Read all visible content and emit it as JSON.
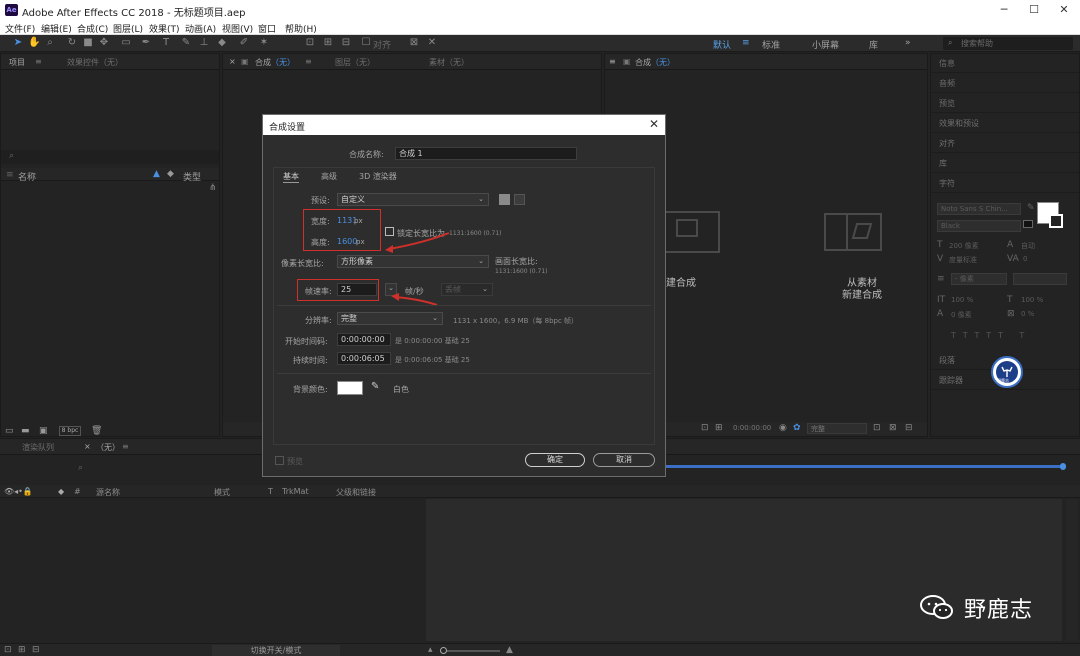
{
  "window": {
    "app_icon": "Ae",
    "title": "Adobe After Effects CC 2018 - 无标题项目.aep"
  },
  "menubar": [
    "文件(F)",
    "编辑(E)",
    "合成(C)",
    "图层(L)",
    "效果(T)",
    "动画(A)",
    "视图(V)",
    "窗口",
    "帮助(H)"
  ],
  "toolbar": {
    "snap_label": "对齐",
    "workspaces": [
      {
        "label": "默认",
        "active": true
      },
      {
        "label": "标准",
        "active": false
      },
      {
        "label": "小屏幕",
        "active": false
      },
      {
        "label": "库",
        "active": false
      }
    ],
    "search_placeholder": "搜索帮助"
  },
  "project_panel": {
    "tab_project": "项目",
    "tab_effects": "效果控件（无）",
    "col_name": "名称",
    "col_type": "类型",
    "bpc": "8 bpc"
  },
  "comp_panel": {
    "tab_comp_prefix": "合成",
    "tab_comp_value": "（无）",
    "tab_layer": "图层（无）",
    "tab_footage": "素材（无）"
  },
  "comp_panel2": {
    "tab_prefix": "合成",
    "tab_value": "（无）",
    "create_comp_text": "建合成",
    "from_footage_line1": "从素材",
    "from_footage_line2": "新建合成",
    "time": "0:00:00:00",
    "quality": "完整"
  },
  "right_panel": {
    "items": [
      "信息",
      "音频",
      "预览",
      "效果和预设",
      "对齐",
      "库",
      "字符"
    ],
    "font_name": "Noto Sans S Chin...",
    "font_style": "Black",
    "font_size": "200 像素",
    "leading": "自动",
    "tracking_label": "度量标准",
    "tracking_value": "0",
    "stroke": "- 像素",
    "scale_v": "100 %",
    "scale_h": "100 %",
    "baseline": "0 像素",
    "tsume": "0 %",
    "paragraph": "段落",
    "tracker": "跟踪器",
    "avatar_text": "野鹿志"
  },
  "dialog": {
    "title": "合成设置",
    "comp_name_label": "合成名称:",
    "comp_name_value": "合成 1",
    "tabs": [
      "基本",
      "高级",
      "3D 渲染器"
    ],
    "preset_label": "预设:",
    "preset_value": "自定义",
    "width_label": "宽度:",
    "width_value": "1131",
    "width_unit": "px",
    "height_label": "高度:",
    "height_value": "1600",
    "height_unit": "px",
    "lock_aspect_label": "锁定长宽比为",
    "lock_aspect_ratio": "1131:1600 (0.71)",
    "pixel_aspect_label": "像素长宽比:",
    "pixel_aspect_value": "方形像素",
    "frame_aspect_label": "画面长宽比:",
    "frame_aspect_value": "1131:1600 (0.71)",
    "framerate_label": "帧速率:",
    "framerate_value": "25",
    "framerate_unit": "帧/秒",
    "drop_frame": "丢帧",
    "resolution_label": "分辨率:",
    "resolution_value": "完整",
    "resolution_info": "1131 x 1600，6.9 MB（每 8bpc 帧）",
    "start_tc_label": "开始时间码:",
    "start_tc_value": "0:00:00:00",
    "start_tc_info": "是 0:00:00:00  基础 25",
    "duration_label": "持续时间:",
    "duration_value": "0:00:06:05",
    "duration_info": "是 0:00:06:05  基础 25",
    "bg_color_label": "背景颜色:",
    "bg_color_name": "白色",
    "preview_label": "预览",
    "ok_label": "确定",
    "cancel_label": "取消"
  },
  "timeline": {
    "tab_render": "渲染队列",
    "tab_comp": "（无）",
    "col_hash": "#",
    "col_source": "源名称",
    "col_mode": "模式",
    "col_t": "T",
    "col_trkmat": "TrkMat",
    "col_parent": "父级和链接",
    "toggle_label": "切换开关/模式"
  },
  "watermark": {
    "text": "野鹿志"
  },
  "colors": {
    "accent_blue": "#4a90e2",
    "annotation_red": "#d0302a",
    "bg_panel": "#232323"
  }
}
